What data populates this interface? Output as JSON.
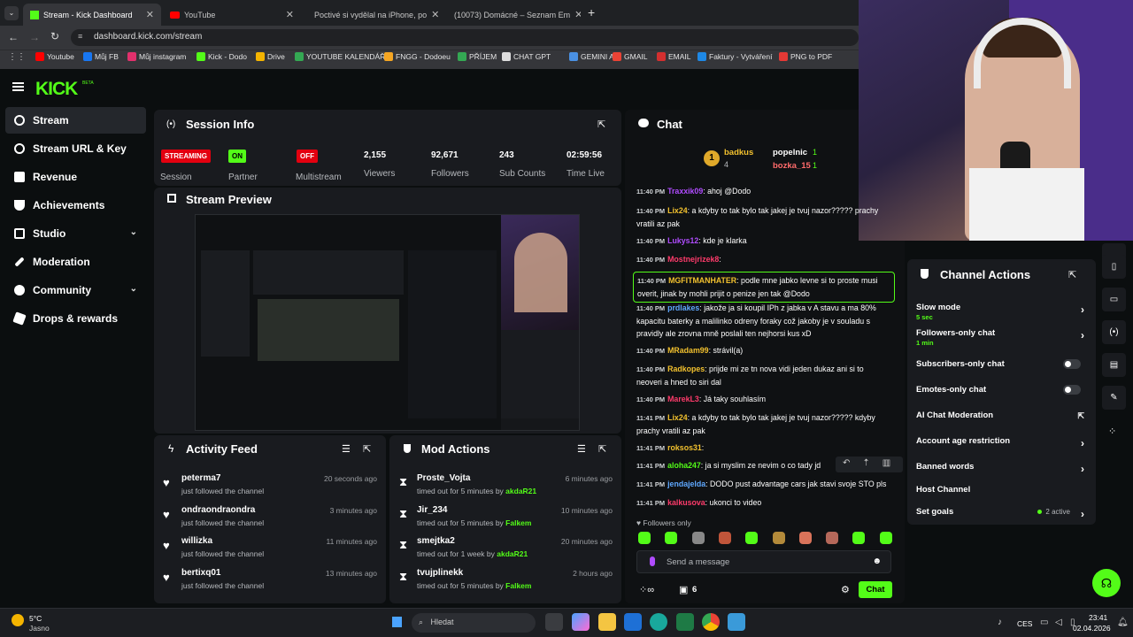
{
  "browser": {
    "tabs": [
      {
        "title": "Stream - Kick Dashboard",
        "color": "#53fc18"
      },
      {
        "title": "YouTube",
        "color": "#ff0000"
      },
      {
        "title": "Poctivé si vydělal na iPhone, po",
        "color": "#e23b3b"
      },
      {
        "title": "(10073) Domácné – Seznam Em",
        "color": "#cc2222"
      }
    ],
    "url": "dashboard.kick.com/stream",
    "bookmarks": [
      {
        "label": "Youtube",
        "color": "#ff0000"
      },
      {
        "label": "Můj FB",
        "color": "#1877f2"
      },
      {
        "label": "Můj instagram",
        "color": "#e1306c"
      },
      {
        "label": "Kick - Dodo",
        "color": "#53fc18"
      },
      {
        "label": "Drive",
        "color": "#f4b400"
      },
      {
        "label": "YOUTUBE KALENDÁŘ",
        "color": "#34a853"
      },
      {
        "label": "FNGG - Dodoeu",
        "color": "#f5a623"
      },
      {
        "label": "PŘÍJEM",
        "color": "#34a853"
      },
      {
        "label": "CHAT GPT",
        "color": "#dddddd"
      },
      {
        "label": "GEMINI AI",
        "color": "#4a90e2"
      },
      {
        "label": "GMAIL",
        "color": "#ea4335"
      },
      {
        "label": "EMAIL",
        "color": "#d32f2f"
      },
      {
        "label": "Faktury - Vytváření",
        "color": "#1e88e5"
      },
      {
        "label": "PNG to PDF",
        "color": "#e53935"
      }
    ]
  },
  "logo": {
    "text": "KICK",
    "beta": "BETA"
  },
  "sidebar": {
    "items": [
      {
        "label": "Stream"
      },
      {
        "label": "Stream URL & Key"
      },
      {
        "label": "Revenue"
      },
      {
        "label": "Achievements"
      },
      {
        "label": "Studio"
      },
      {
        "label": "Moderation"
      },
      {
        "label": "Community"
      },
      {
        "label": "Drops & rewards"
      }
    ]
  },
  "session": {
    "title": "Session Info",
    "status": "STREAMING",
    "status_label": "Session",
    "partner_badge": "ON",
    "partner_label": "Partner",
    "multistream_badge": "OFF",
    "multistream_label": "Multistream",
    "viewers": "2,155",
    "viewers_label": "Viewers",
    "followers": "92,671",
    "followers_label": "Followers",
    "subs": "243",
    "subs_label": "Sub Counts",
    "time_live": "02:59:56",
    "time_live_label": "Time Live"
  },
  "preview": {
    "title": "Stream Preview"
  },
  "activity": {
    "title": "Activity Feed",
    "items": [
      {
        "name": "peterma7",
        "action": "just followed the channel",
        "time": "20 seconds ago"
      },
      {
        "name": "ondraondraondra",
        "action": "just followed the channel",
        "time": "3 minutes ago"
      },
      {
        "name": "willizka",
        "action": "just followed the channel",
        "time": "11 minutes ago"
      },
      {
        "name": "bertixq01",
        "action": "just followed the channel",
        "time": "13 minutes ago"
      }
    ]
  },
  "modactions": {
    "title": "Mod Actions",
    "items": [
      {
        "name": "Proste_Vojta",
        "action": "timed out for 5 minutes by",
        "mod": "akdaR21",
        "time": "6 minutes ago"
      },
      {
        "name": "Jir_234",
        "action": "timed out for 5 minutes by",
        "mod": "Falkem",
        "time": "10 minutes ago"
      },
      {
        "name": "smejtka2",
        "action": "timed out for 1 week by",
        "mod": "akdaR21",
        "time": "20 minutes ago"
      },
      {
        "name": "tvujplinekk",
        "action": "timed out for 5 minutes by",
        "mod": "Falkem",
        "time": "2 hours ago"
      }
    ]
  },
  "chat": {
    "title": "Chat",
    "leaders": [
      {
        "rank": "1",
        "name": "badkus",
        "count": "4"
      },
      {
        "name": "popelnic",
        "count": "1"
      },
      {
        "name": "bozka_15",
        "count": "1"
      }
    ],
    "messages": [
      {
        "time": "11:40 PM",
        "user": "Traxxik09",
        "color": "#b04cff",
        "text": "ahoj @Dodo"
      },
      {
        "time": "11:40 PM",
        "user": "Lix24",
        "color": "#f2c12e",
        "text": "a kdyby to tak bylo tak jakej je tvuj nazor????? prachy vratili az pak"
      },
      {
        "time": "11:40 PM",
        "user": "Lukys12",
        "color": "#b04cff",
        "text": "kde je klarka"
      },
      {
        "time": "11:40 PM",
        "user": "Mostnejrizek8",
        "color": "#ff3b6b",
        "text": ""
      },
      {
        "time": "11:40 PM",
        "user": "MGFITMANHATER",
        "color": "#f2c12e",
        "text": "podle mne jabko levne si to proste musi overit, jinak by mohli prijit o penize jen tak @Dodo"
      },
      {
        "time": "11:40 PM",
        "user": "prdlakes",
        "color": "#5fa8ff",
        "text": "jakože ja si koupil IPh z jabka v A stavu a ma 80% kapacitu baterky a malilinko odreny foraky což jakoby je v souladu s pravidly ale zrovna mně poslali ten nejhorsi kus xD"
      },
      {
        "time": "11:40 PM",
        "user": "MRadam99",
        "color": "#f2c12e",
        "text": "strávil(a)"
      },
      {
        "time": "11:40 PM",
        "user": "Radkopes",
        "color": "#f2c12e",
        "text": "prijde mi ze tn nova vidi jeden dukaz ani si to neoveri a hned to siri dal"
      },
      {
        "time": "11:40 PM",
        "user": "MarekL3",
        "color": "#ff3b6b",
        "text": "Já taky souhlasím"
      },
      {
        "time": "11:41 PM",
        "user": "Lix24",
        "color": "#f2c12e",
        "text": "a kdyby to tak bylo tak jakej je tvuj nazor????? kdyby prachy vratili az pak"
      },
      {
        "time": "11:41 PM",
        "user": "roksos31",
        "color": "#f2c12e",
        "text": ""
      },
      {
        "time": "11:41 PM",
        "user": "aloha247",
        "color": "#53fc18",
        "text": "ja si myslim ze nevim o co tady jd"
      },
      {
        "time": "11:41 PM",
        "user": "jendajelda",
        "color": "#5fa8ff",
        "text": "DODO pust advantage cars jak stavi svoje STO pls"
      },
      {
        "time": "11:41 PM",
        "user": "kalkusova",
        "color": "#ff3b6b",
        "text": "ukonci to video"
      }
    ],
    "followers_only": "Followers only",
    "input_placeholder": "Send a message",
    "count": "6",
    "send_label": "Chat"
  },
  "channel_actions": {
    "title": "Channel Actions",
    "items": [
      {
        "label": "Slow mode",
        "sub": "5 sec",
        "type": "arrow"
      },
      {
        "label": "Followers-only chat",
        "sub": "1 min",
        "type": "arrow"
      },
      {
        "label": "Subscribers-only chat",
        "type": "toggle"
      },
      {
        "label": "Emotes-only chat",
        "type": "toggle"
      },
      {
        "label": "AI Chat Moderation",
        "type": "external"
      },
      {
        "label": "Account age restriction",
        "type": "arrow"
      },
      {
        "label": "Banned words",
        "type": "arrow"
      },
      {
        "label": "Host Channel",
        "type": "none"
      },
      {
        "label": "Set goals",
        "type": "arrow",
        "extra": "2 active"
      }
    ]
  },
  "taskbar": {
    "weather_temp": "5°C",
    "weather_desc": "Jasno",
    "search_placeholder": "Hledat",
    "lang": "CES",
    "time": "23:41",
    "date": "02.04.2026"
  },
  "colors": {
    "accent": "#53fc18",
    "panel": "#191b1f",
    "bg": "#0b0e0f",
    "badge_red": "#e3000f"
  }
}
